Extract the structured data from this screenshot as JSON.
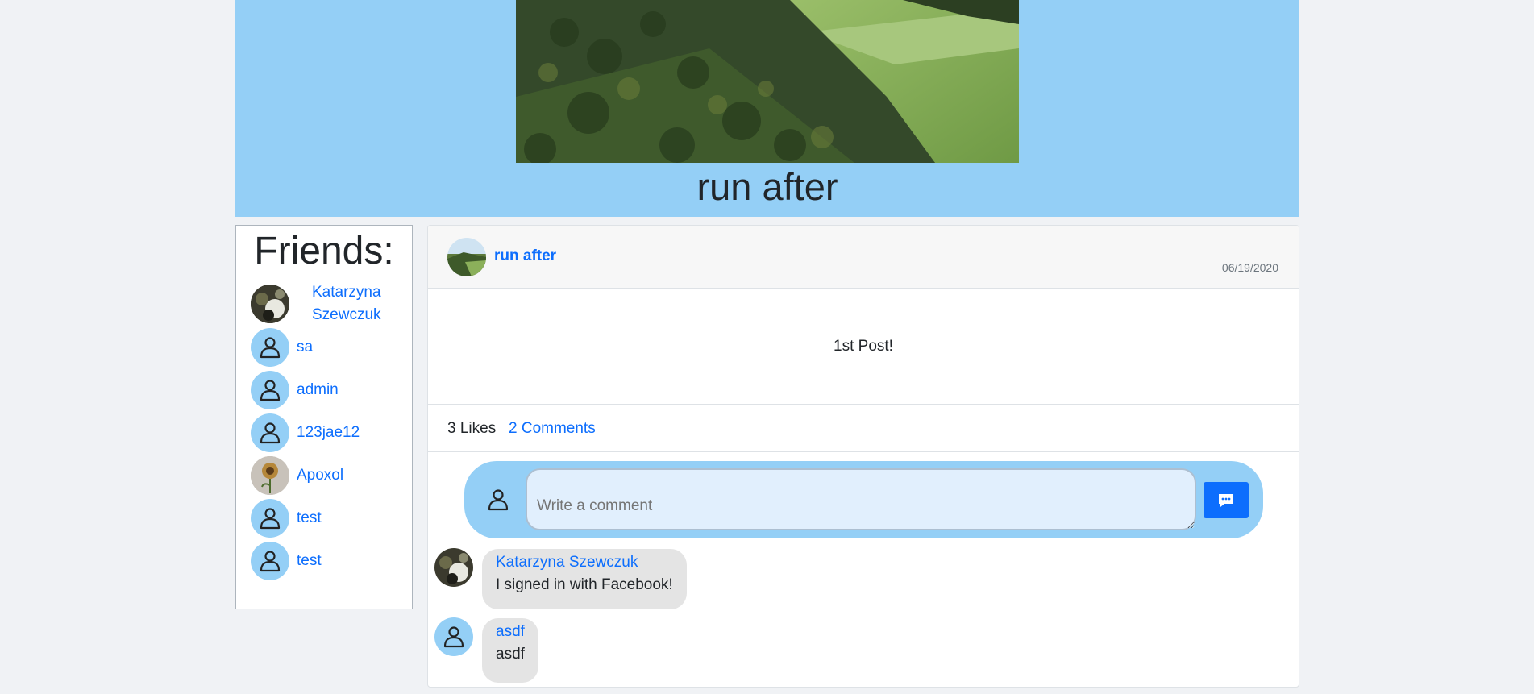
{
  "header": {
    "cover_image": "valley-landscape-photo",
    "title": "run after"
  },
  "friends": {
    "title": "Friends:",
    "items": [
      {
        "name": "Katarzyna Szewczuk",
        "avatar": "photo"
      },
      {
        "name": "sa",
        "avatar": "person-icon"
      },
      {
        "name": "admin",
        "avatar": "person-icon"
      },
      {
        "name": "123jae12",
        "avatar": "person-icon"
      },
      {
        "name": "Apoxol",
        "avatar": "photo"
      },
      {
        "name": "test",
        "avatar": "person-icon"
      },
      {
        "name": "test",
        "avatar": "person-icon"
      }
    ]
  },
  "post": {
    "author": "run after",
    "date": "06/19/2020",
    "text": "1st Post!",
    "likes": "3 Likes",
    "comments_link": "2 Comments",
    "comment_input": {
      "placeholder": "Write a comment",
      "send_icon": "comment-dots-icon"
    },
    "comments": [
      {
        "author": "Katarzyna Szewczuk",
        "text": "I signed in with Facebook!",
        "avatar": "photo"
      },
      {
        "author": "asdf",
        "text": "asdf",
        "avatar": "person-icon"
      }
    ]
  },
  "colors": {
    "accent": "#0d6efd",
    "header_bg": "#94cff6",
    "page_bg": "#f0f2f5",
    "bubble_bg": "#e4e4e4",
    "input_bg": "#e1effd"
  }
}
